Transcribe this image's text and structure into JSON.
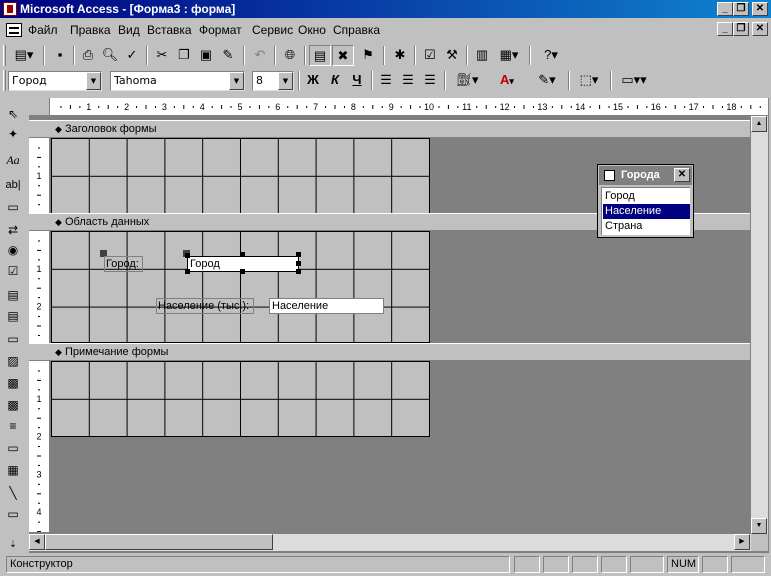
{
  "window": {
    "title": "Microsoft Access - [Форма3 : форма]"
  },
  "menu": [
    "Файл",
    "Правка",
    "Вид",
    "Вставка",
    "Формат",
    "Сервис",
    "Окно",
    "Справка"
  ],
  "formatting": {
    "object": "Город",
    "font": "Tahoma",
    "size": "8",
    "bold": "Ж",
    "italic": "К",
    "underline": "Ч",
    "font_color_glyph": "A"
  },
  "toolbox_glyphs": {
    "label": "Aa",
    "textbox": "ab|"
  },
  "ruler": {
    "horizontal": [
      "1",
      "2",
      "3",
      "4",
      "5",
      "6",
      "7",
      "8",
      "9",
      "10",
      "11",
      "12",
      "13",
      "14",
      "15",
      "16",
      "17",
      "18"
    ],
    "vertical_header": [
      "1"
    ],
    "vertical_detail": [
      "1",
      "2"
    ],
    "vertical_footer": [
      "1",
      "2",
      "3",
      "4",
      "5"
    ]
  },
  "sections": {
    "header": "Заголовок формы",
    "detail": "Область данных",
    "footer": "Примечание формы"
  },
  "controls": {
    "city_label": "Город:",
    "city_field": "Город",
    "population_label": "Население (тыс.):",
    "population_field": "Население"
  },
  "field_list": {
    "title": "Города",
    "close": "✕",
    "items": [
      "Город",
      "Население",
      "Страна"
    ],
    "selected": "Население"
  },
  "status": {
    "text": "Конструктор",
    "num": "NUM"
  },
  "colors": {
    "titlebar": "#000080",
    "selection": "#000080",
    "workspace": "#808080",
    "grid": "#c0c0c0"
  }
}
